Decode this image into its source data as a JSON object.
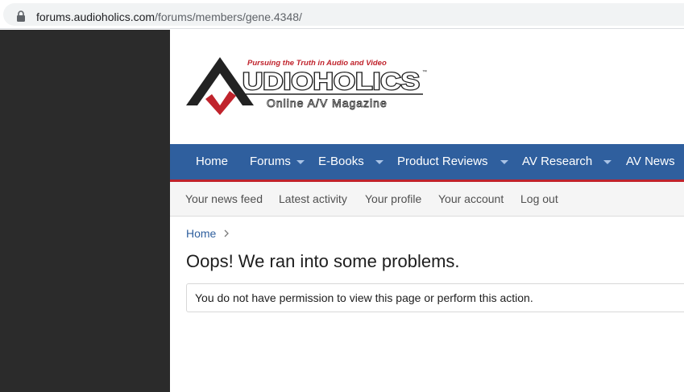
{
  "browser": {
    "url_host": "forums.audioholics.com",
    "url_path": "/forums/members/gene.4348/"
  },
  "logo": {
    "tagline": "Pursuing the Truth in Audio and Video",
    "wordmark": "UDIOHOLICS",
    "trademark": "™",
    "subtitle": "Online A/V Magazine"
  },
  "nav": {
    "items": [
      {
        "label": "Home"
      },
      {
        "label": "Forums"
      },
      {
        "label": "E-Books"
      },
      {
        "label": "Product Reviews"
      },
      {
        "label": "AV Research"
      },
      {
        "label": "AV News"
      }
    ]
  },
  "subnav": {
    "items": [
      {
        "label": "Your news feed"
      },
      {
        "label": "Latest activity"
      },
      {
        "label": "Your profile"
      },
      {
        "label": "Your account"
      },
      {
        "label": "Log out"
      }
    ]
  },
  "breadcrumb": {
    "home": "Home"
  },
  "error": {
    "title": "Oops! We ran into some problems.",
    "message": "You do not have permission to view this page or perform this action."
  },
  "colors": {
    "nav_blue": "#2f5f9e",
    "accent_red": "#c0232c",
    "gutter": "#2b2b2b"
  }
}
